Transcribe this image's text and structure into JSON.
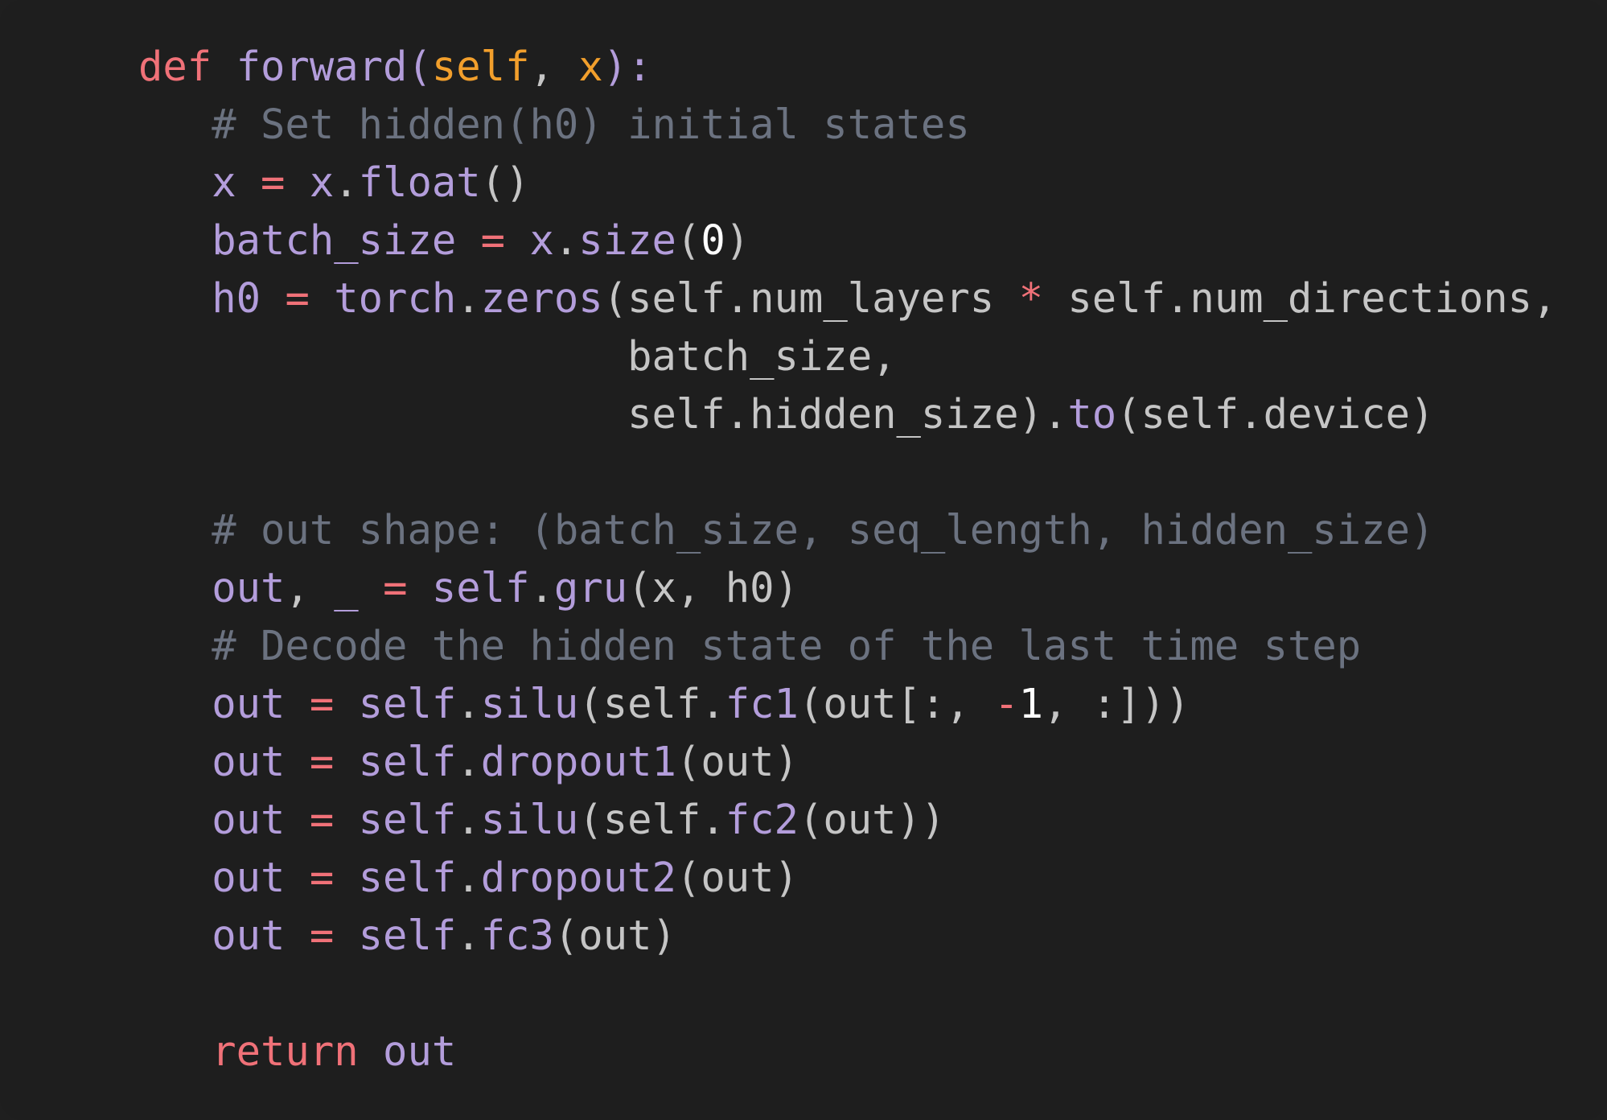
{
  "colors": {
    "background": "#1e1e1e",
    "keyword": "#f07178",
    "function": "#b39ddb",
    "parameter": "#f29f2c",
    "comment": "#6b7280",
    "text": "#c5c5c5",
    "number": "#ffffff"
  },
  "code": {
    "lines": [
      [
        {
          "t": "def",
          "c": "keyword"
        },
        {
          "t": " ",
          "c": "text"
        },
        {
          "t": "forward(",
          "c": "func"
        },
        {
          "t": "self",
          "c": "param"
        },
        {
          "t": ", ",
          "c": "text"
        },
        {
          "t": "x",
          "c": "param"
        },
        {
          "t": "):",
          "c": "func"
        }
      ],
      [
        {
          "t": "   # Set hidden(h0) initial states",
          "c": "comment"
        }
      ],
      [
        {
          "t": "   ",
          "c": "text"
        },
        {
          "t": "x",
          "c": "ident"
        },
        {
          "t": " ",
          "c": "text"
        },
        {
          "t": "=",
          "c": "op"
        },
        {
          "t": " ",
          "c": "text"
        },
        {
          "t": "x",
          "c": "ident"
        },
        {
          "t": ".",
          "c": "text"
        },
        {
          "t": "float",
          "c": "ident"
        },
        {
          "t": "()",
          "c": "text"
        }
      ],
      [
        {
          "t": "   ",
          "c": "text"
        },
        {
          "t": "batch_size",
          "c": "ident"
        },
        {
          "t": " ",
          "c": "text"
        },
        {
          "t": "=",
          "c": "op"
        },
        {
          "t": " ",
          "c": "text"
        },
        {
          "t": "x",
          "c": "ident"
        },
        {
          "t": ".",
          "c": "text"
        },
        {
          "t": "size",
          "c": "ident"
        },
        {
          "t": "(",
          "c": "text"
        },
        {
          "t": "0",
          "c": "number"
        },
        {
          "t": ")",
          "c": "text"
        }
      ],
      [
        {
          "t": "   ",
          "c": "text"
        },
        {
          "t": "h0",
          "c": "ident"
        },
        {
          "t": " ",
          "c": "text"
        },
        {
          "t": "=",
          "c": "op"
        },
        {
          "t": " ",
          "c": "text"
        },
        {
          "t": "torch",
          "c": "ident"
        },
        {
          "t": ".",
          "c": "text"
        },
        {
          "t": "zeros",
          "c": "ident"
        },
        {
          "t": "(self.num_layers ",
          "c": "text"
        },
        {
          "t": "*",
          "c": "op"
        },
        {
          "t": " self.num_directions,",
          "c": "text"
        }
      ],
      [
        {
          "t": "                    batch_size,",
          "c": "text"
        }
      ],
      [
        {
          "t": "                    self.hidden_size).",
          "c": "text"
        },
        {
          "t": "to",
          "c": "ident"
        },
        {
          "t": "(self.device)",
          "c": "text"
        }
      ],
      [
        {
          "t": "",
          "c": "text"
        }
      ],
      [
        {
          "t": "   # out shape: (batch_size, seq_length, hidden_size)",
          "c": "comment"
        }
      ],
      [
        {
          "t": "   ",
          "c": "text"
        },
        {
          "t": "out",
          "c": "ident"
        },
        {
          "t": ", ",
          "c": "text"
        },
        {
          "t": "_",
          "c": "ident"
        },
        {
          "t": " ",
          "c": "text"
        },
        {
          "t": "=",
          "c": "op"
        },
        {
          "t": " ",
          "c": "text"
        },
        {
          "t": "self",
          "c": "ident"
        },
        {
          "t": ".",
          "c": "text"
        },
        {
          "t": "gru",
          "c": "ident"
        },
        {
          "t": "(x, h0)",
          "c": "text"
        }
      ],
      [
        {
          "t": "   # Decode the hidden state of the last time step",
          "c": "comment"
        }
      ],
      [
        {
          "t": "   ",
          "c": "text"
        },
        {
          "t": "out",
          "c": "ident"
        },
        {
          "t": " ",
          "c": "text"
        },
        {
          "t": "=",
          "c": "op"
        },
        {
          "t": " ",
          "c": "text"
        },
        {
          "t": "self",
          "c": "ident"
        },
        {
          "t": ".",
          "c": "text"
        },
        {
          "t": "silu",
          "c": "ident"
        },
        {
          "t": "(self.",
          "c": "text"
        },
        {
          "t": "fc1",
          "c": "ident"
        },
        {
          "t": "(out[:, ",
          "c": "text"
        },
        {
          "t": "-",
          "c": "op"
        },
        {
          "t": "1",
          "c": "number"
        },
        {
          "t": ", :]))",
          "c": "text"
        }
      ],
      [
        {
          "t": "   ",
          "c": "text"
        },
        {
          "t": "out",
          "c": "ident"
        },
        {
          "t": " ",
          "c": "text"
        },
        {
          "t": "=",
          "c": "op"
        },
        {
          "t": " ",
          "c": "text"
        },
        {
          "t": "self",
          "c": "ident"
        },
        {
          "t": ".",
          "c": "text"
        },
        {
          "t": "dropout1",
          "c": "ident"
        },
        {
          "t": "(out)",
          "c": "text"
        }
      ],
      [
        {
          "t": "   ",
          "c": "text"
        },
        {
          "t": "out",
          "c": "ident"
        },
        {
          "t": " ",
          "c": "text"
        },
        {
          "t": "=",
          "c": "op"
        },
        {
          "t": " ",
          "c": "text"
        },
        {
          "t": "self",
          "c": "ident"
        },
        {
          "t": ".",
          "c": "text"
        },
        {
          "t": "silu",
          "c": "ident"
        },
        {
          "t": "(self.",
          "c": "text"
        },
        {
          "t": "fc2",
          "c": "ident"
        },
        {
          "t": "(out))",
          "c": "text"
        }
      ],
      [
        {
          "t": "   ",
          "c": "text"
        },
        {
          "t": "out",
          "c": "ident"
        },
        {
          "t": " ",
          "c": "text"
        },
        {
          "t": "=",
          "c": "op"
        },
        {
          "t": " ",
          "c": "text"
        },
        {
          "t": "self",
          "c": "ident"
        },
        {
          "t": ".",
          "c": "text"
        },
        {
          "t": "dropout2",
          "c": "ident"
        },
        {
          "t": "(out)",
          "c": "text"
        }
      ],
      [
        {
          "t": "   ",
          "c": "text"
        },
        {
          "t": "out",
          "c": "ident"
        },
        {
          "t": " ",
          "c": "text"
        },
        {
          "t": "=",
          "c": "op"
        },
        {
          "t": " ",
          "c": "text"
        },
        {
          "t": "self",
          "c": "ident"
        },
        {
          "t": ".",
          "c": "text"
        },
        {
          "t": "fc3",
          "c": "ident"
        },
        {
          "t": "(out)",
          "c": "text"
        }
      ],
      [
        {
          "t": "",
          "c": "text"
        }
      ],
      [
        {
          "t": "   ",
          "c": "text"
        },
        {
          "t": "return",
          "c": "keyword"
        },
        {
          "t": " ",
          "c": "text"
        },
        {
          "t": "out",
          "c": "ident"
        }
      ]
    ]
  }
}
